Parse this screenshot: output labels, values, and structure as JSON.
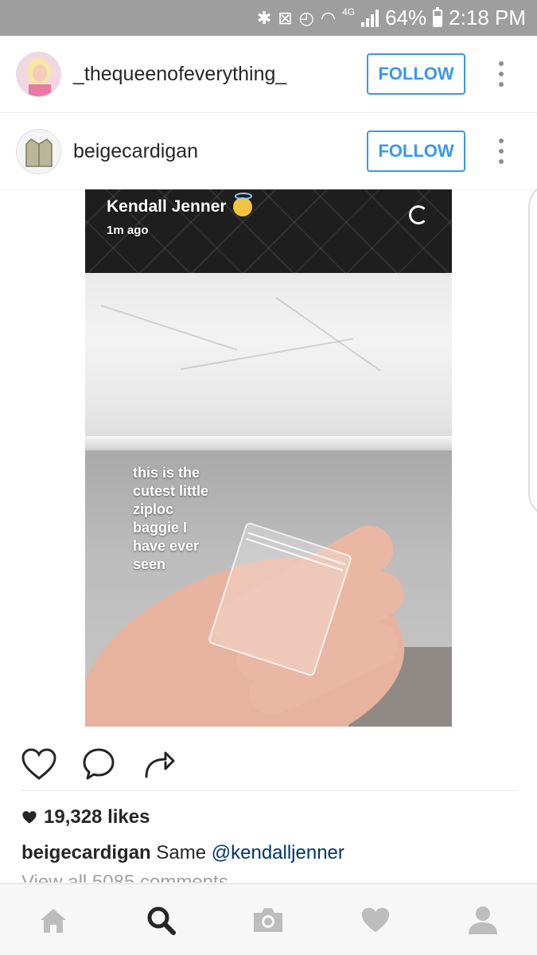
{
  "status_bar": {
    "network_label": "4G",
    "battery": "64%",
    "time": "2:18 PM",
    "icons": [
      "bluetooth-icon",
      "mute-vibrate-icon",
      "alarm-icon",
      "wifi-icon",
      "signal-icon",
      "battery-icon"
    ]
  },
  "suggested_users": [
    {
      "username": "_thequeenofeverything_",
      "follow_label": "FOLLOW",
      "avatar": "barbie-avatar"
    },
    {
      "username": "beigecardigan",
      "follow_label": "FOLLOW",
      "avatar": "cardigan-avatar"
    }
  ],
  "post": {
    "snap": {
      "name": "Kendall Jenner",
      "time": "1m ago",
      "caption": "this is the\ncutest little\nziploc\nbaggie I\nhave ever\nseen"
    },
    "likes": "19,328 likes",
    "caption_user": "beigecardigan",
    "caption_text": "Same",
    "caption_mention": "@kendalljenner",
    "comments_link": "View all 5085 comments"
  },
  "bottom_nav": {
    "items": [
      "home-icon",
      "search-icon",
      "camera-icon",
      "heart-icon",
      "profile-icon"
    ],
    "active": "search-icon",
    "inactive_color": "#bdbdbd",
    "active_color": "#262626"
  },
  "colors": {
    "accent": "#3897f0",
    "mention": "#003569",
    "status_bar_bg": "#9e9e9e"
  }
}
